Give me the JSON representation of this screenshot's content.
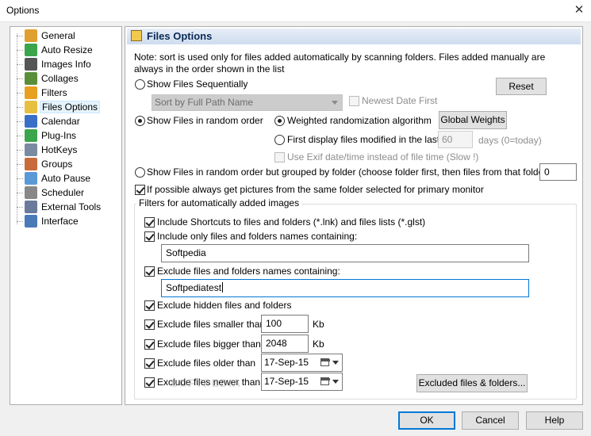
{
  "window": {
    "title": "Options",
    "close_glyph": "✕"
  },
  "nav": {
    "items": [
      {
        "label": "General",
        "icon": "pencil-icon",
        "color": "#e0a030"
      },
      {
        "label": "Auto Resize",
        "icon": "resize-icon",
        "color": "#3aa54a"
      },
      {
        "label": "Images Info",
        "icon": "grid-icon",
        "color": "#555555"
      },
      {
        "label": "Collages",
        "icon": "collage-icon",
        "color": "#5a8f3a"
      },
      {
        "label": "Filters",
        "icon": "funnel-icon",
        "color": "#e8a020"
      },
      {
        "label": "Files Options",
        "icon": "files-icon",
        "color": "#e8c040"
      },
      {
        "label": "Calendar",
        "icon": "calendar-icon",
        "color": "#3a6fc8"
      },
      {
        "label": "Plug-Ins",
        "icon": "puzzle-icon",
        "color": "#3aa54a"
      },
      {
        "label": "HotKeys",
        "icon": "keyboard-icon",
        "color": "#7a8aa0"
      },
      {
        "label": "Groups",
        "icon": "users-icon",
        "color": "#c86a3a"
      },
      {
        "label": "Auto Pause",
        "icon": "pause-icon",
        "color": "#5a9ad8"
      },
      {
        "label": "Scheduler",
        "icon": "clock-icon",
        "color": "#888888"
      },
      {
        "label": "External Tools",
        "icon": "wrench-icon",
        "color": "#6a7a9a"
      },
      {
        "label": "Interface",
        "icon": "window-icon",
        "color": "#4a7ab8"
      }
    ],
    "selected": "Files Options"
  },
  "panel": {
    "title": "Files Options",
    "note": "Note: sort is used only for files added automatically by scanning folders. Files added manually are always in the order shown in the list",
    "reset_label": "Reset",
    "sequential_label": "Show Files Sequentially",
    "sort_combo_value": "Sort by Full Path Name",
    "newest_date_first_label": "Newest Date First",
    "random_label": "Show Files in random order",
    "weighted_label": "Weighted randomization algorithm",
    "global_weights_label": "Global Weights",
    "first_display_label": "First display files modified in the last:",
    "days_value": "60",
    "days_label": "days (0=today)",
    "exif_label": "Use Exif date/time instead of file time (Slow !)",
    "grouped_label": "Show Files in random order but grouped by folder (choose folder first, then files from that folder), Max",
    "grouped_max_value": "0",
    "same_folder_label": "If possible always get pictures from the same folder selected for primary monitor",
    "filters": {
      "group_title": "Filters for automatically added images",
      "include_shortcuts_label": "Include Shortcuts to files and folders (*.lnk) and files lists (*.glst)",
      "include_only_label": "Include only files and folders names containing:",
      "include_only_value": "Softpedia",
      "exclude_names_label": "Exclude files and folders names containing:",
      "exclude_names_value": "Softpediatest",
      "exclude_hidden_label": "Exclude hidden files and folders",
      "smaller_label": "Exclude files smaller than",
      "smaller_value": "100",
      "smaller_unit": "Kb",
      "bigger_label": "Exclude files bigger than",
      "bigger_value": "2048",
      "bigger_unit": "Kb",
      "older_label": "Exclude files older than",
      "older_value": "17-Sep-15",
      "newer_label": "Exclude files newer than",
      "newer_value": "17-Sep-15",
      "excluded_button_label": "Excluded files & folders..."
    }
  },
  "footer": {
    "ok_label": "OK",
    "cancel_label": "Cancel",
    "help_label": "Help"
  },
  "watermark": "SOFTPEDIA"
}
